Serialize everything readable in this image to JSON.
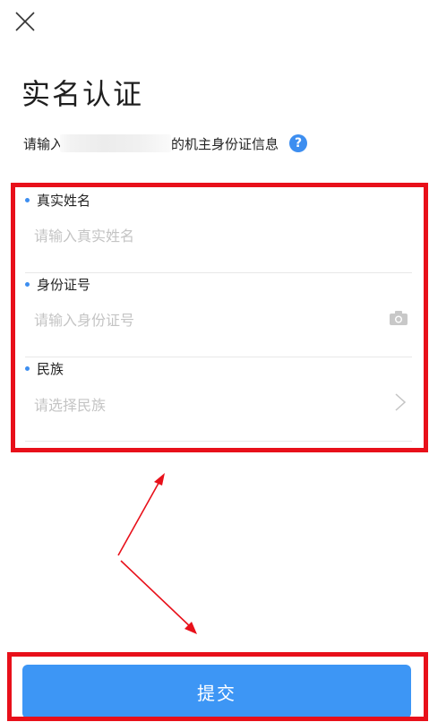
{
  "header": {
    "title": "实名认证"
  },
  "subtitle": {
    "prefix": "请输入",
    "suffix": "的机主身份证信息",
    "help_icon": "?"
  },
  "form": {
    "fields": [
      {
        "label": "真实姓名",
        "placeholder": "请输入真实姓名"
      },
      {
        "label": "身份证号",
        "placeholder": "请输入身份证号"
      },
      {
        "label": "民族",
        "placeholder": "请选择民族"
      }
    ]
  },
  "submit": {
    "label": "提交"
  },
  "colors": {
    "accent": "#3d8ef0",
    "button": "#3d96f5",
    "annotation": "#e8101a"
  },
  "icons": [
    "close-icon",
    "help-icon",
    "camera-icon",
    "chevron-right-icon"
  ]
}
